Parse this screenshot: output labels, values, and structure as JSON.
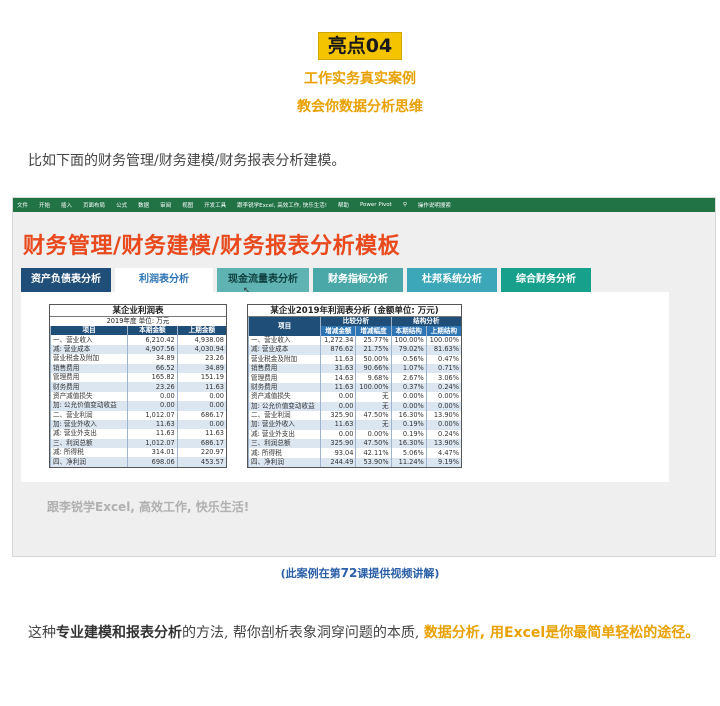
{
  "badge": "亮点04",
  "subtitle1": "工作实务真实案例",
  "subtitle2": "教会你数据分析思维",
  "intro": "比如下面的财务管理/财务建模/财务报表分析建模。",
  "ribbon": [
    "文件",
    "开始",
    "插入",
    "页面布局",
    "公式",
    "数据",
    "审阅",
    "视图",
    "开发工具",
    "跟李锐学Excel, 高效工作, 快乐生活!",
    "帮助",
    "Power Pivot",
    "操作说明搜索"
  ],
  "sheet_title": "财务管理/财务建模/财务报表分析模板",
  "tabs": [
    "资产负债表分析",
    "利润表分析",
    "现金流量表分析",
    "财务指标分析",
    "杜邦系统分析",
    "综合财务分析"
  ],
  "left_table": {
    "title": "某企业利润表",
    "subtitle": "2019年度     单位: 万元",
    "headers": [
      "项目",
      "本期金额",
      "上期金额"
    ],
    "rows": [
      [
        "一、营业收入",
        "6,210.42",
        "4,938.08"
      ],
      [
        "减: 营业成本",
        "4,907.56",
        "4,030.94"
      ],
      [
        "    营业税金及附加",
        "34.89",
        "23.26"
      ],
      [
        "    销售费用",
        "66.52",
        "34.89"
      ],
      [
        "        管理费用",
        "165.82",
        "151.19"
      ],
      [
        "        财务费用",
        "23.26",
        "11.63"
      ],
      [
        "        资产减值损失",
        "0.00",
        "0.00"
      ],
      [
        "加: 公允价值变动收益",
        "0.00",
        "0.00"
      ],
      [
        "二、营业利润",
        "1,012.07",
        "686.17"
      ],
      [
        "加: 营业外收入",
        "11.63",
        "0.00"
      ],
      [
        "减: 营业外支出",
        "11.63",
        "11.63"
      ],
      [
        "三、利润总额",
        "1,012.07",
        "686.17"
      ],
      [
        "减: 所得税",
        "314.01",
        "220.97"
      ],
      [
        "四、净利润",
        "698.06",
        "453.57"
      ]
    ]
  },
  "right_table": {
    "title": "某企业2019年利润表分析 (金额单位: 万元)",
    "group_headers": [
      "项目",
      "比较分析",
      "结构分析"
    ],
    "headers": [
      "增减金额",
      "增减幅度",
      "本期结构",
      "上期结构"
    ],
    "rows": [
      [
        "一、营业收入",
        "1,272.34",
        "25.77%",
        "100.00%",
        "100.00%"
      ],
      [
        "减: 营业成本",
        "876.62",
        "21.75%",
        "79.02%",
        "81.63%"
      ],
      [
        "    营业税金及附加",
        "11.63",
        "50.00%",
        "0.56%",
        "0.47%"
      ],
      [
        "    销售费用",
        "31.63",
        "90.66%",
        "1.07%",
        "0.71%"
      ],
      [
        "        管理费用",
        "14.63",
        "9.68%",
        "2.67%",
        "3.06%"
      ],
      [
        "        财务费用",
        "11.63",
        "100.00%",
        "0.37%",
        "0.24%"
      ],
      [
        "        资产减值损失",
        "0.00",
        "无",
        "0.00%",
        "0.00%"
      ],
      [
        "加: 公允价值变动收益",
        "0.00",
        "无",
        "0.00%",
        "0.00%"
      ],
      [
        "二、营业利润",
        "325.90",
        "47.50%",
        "16.30%",
        "13.90%"
      ],
      [
        "加: 营业外收入",
        "11.63",
        "无",
        "0.19%",
        "0.00%"
      ],
      [
        "减: 营业外支出",
        "0.00",
        "0.00%",
        "0.19%",
        "0.24%"
      ],
      [
        "三、利润总额",
        "325.90",
        "47.50%",
        "16.30%",
        "13.90%"
      ],
      [
        "减: 所得税",
        "93.04",
        "42.11%",
        "5.06%",
        "4.47%"
      ],
      [
        "四、净利润",
        "244.49",
        "53.90%",
        "11.24%",
        "9.19%"
      ]
    ]
  },
  "slogan": "跟李锐学Excel, 高效工作, 快乐生活!",
  "caption": {
    "pre": "(此案例在第",
    "num": "72",
    "post": "课提供视频讲解)"
  },
  "outro": {
    "p1": "这种",
    "b1": "专业建模和报表分析",
    "p2": "的方法, 帮你剖析表象洞穿问题的本质, ",
    "hl": "数据分析, 用Excel是你最简单轻松的途径。"
  },
  "colors": {
    "accent": "#e8a100",
    "badge": "#f5c400",
    "excel_green": "#217346",
    "title_red": "#e8491d",
    "caption_blue": "#2a5fa8"
  }
}
